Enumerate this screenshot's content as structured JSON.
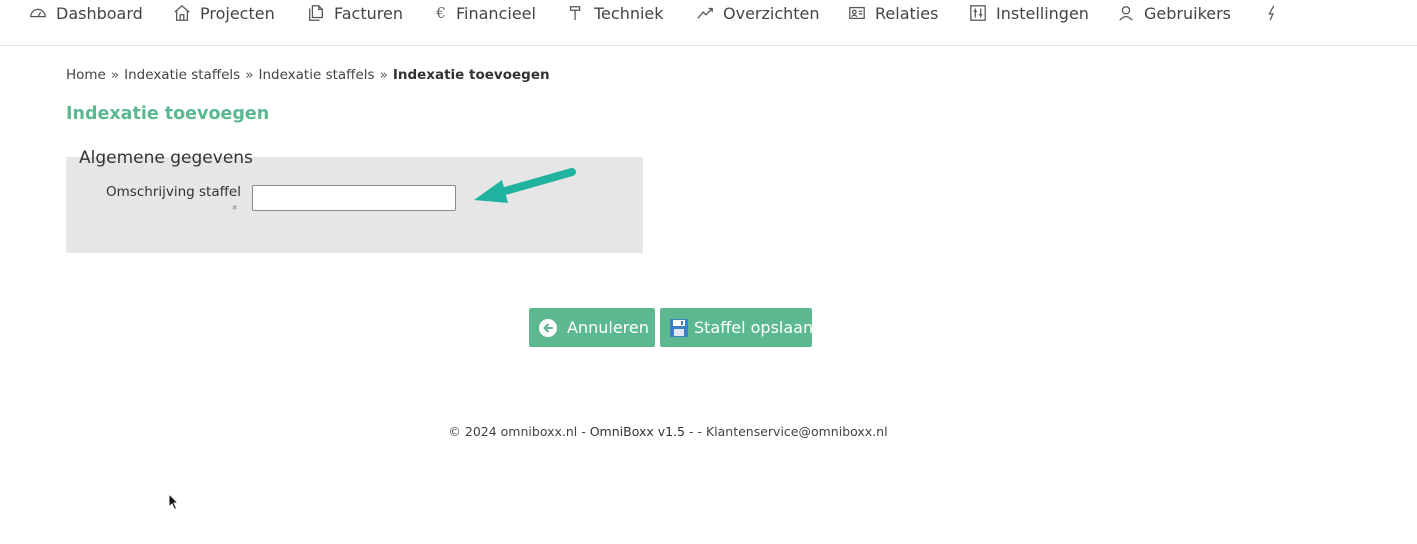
{
  "nav": {
    "items": [
      {
        "label": "Dashboard",
        "icon": "dashboard-icon"
      },
      {
        "label": "Projecten",
        "icon": "home-icon"
      },
      {
        "label": "Facturen",
        "icon": "documents-icon"
      },
      {
        "label": "Financieel",
        "icon": "euro-icon"
      },
      {
        "label": "Techniek",
        "icon": "hammer-icon"
      },
      {
        "label": "Overzichten",
        "icon": "trend-chart-icon"
      },
      {
        "label": "Relaties",
        "icon": "id-card-icon"
      },
      {
        "label": "Instellingen",
        "icon": "sliders-icon"
      },
      {
        "label": "Gebruikers",
        "icon": "user-icon"
      },
      {
        "label": "",
        "icon": "lightning-icon"
      }
    ],
    "euro_symbol": "€"
  },
  "breadcrumb": {
    "items": [
      "Home",
      "Indexatie staffels",
      "Indexatie staffels",
      "Indexatie toevoegen"
    ],
    "separator": "»"
  },
  "page": {
    "title": "Indexatie toevoegen"
  },
  "form": {
    "legend": "Algemene gegevens",
    "field_label": "Omschrijving staffel",
    "required_marker": "*",
    "field_value": ""
  },
  "buttons": {
    "cancel_label": "Annuleren",
    "save_label": "Staffel opslaan"
  },
  "footer": {
    "copyright": "© 2024 omniboxx.nl - ",
    "brand": "OmniBoxx v1.5",
    "rest": " - - Klantenservice@omniboxx.nl"
  },
  "colors": {
    "accent": "#5cb890",
    "arrow": "#1fb3a0",
    "panel": "#e6e6e6"
  }
}
